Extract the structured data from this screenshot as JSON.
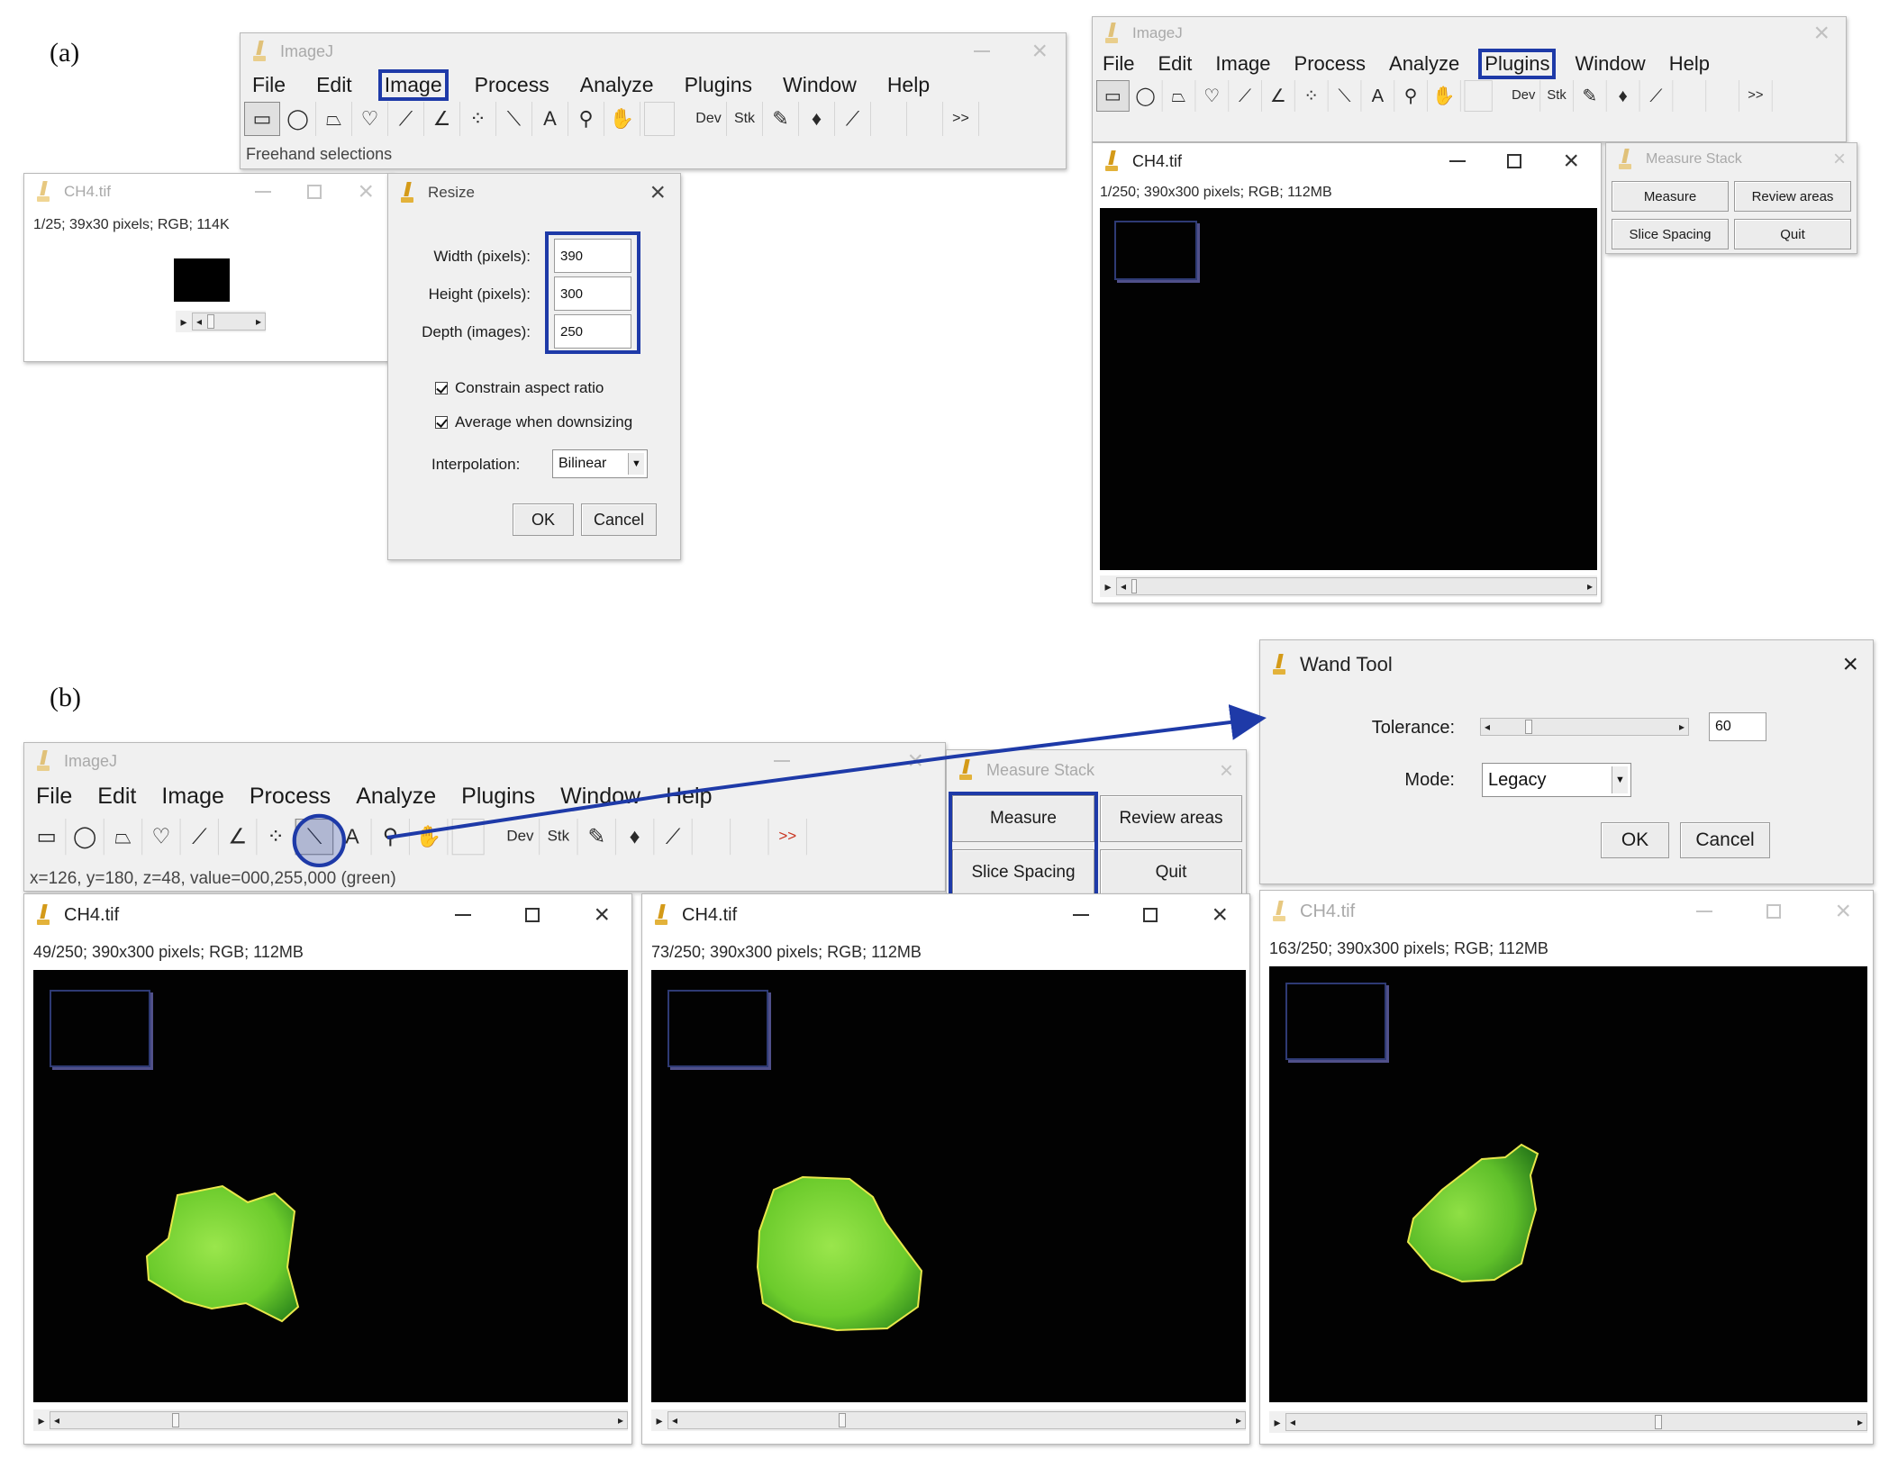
{
  "panel_a": {
    "label": "(a)"
  },
  "panel_b": {
    "label": "(b)"
  },
  "imagej": {
    "title": "ImageJ",
    "menus": [
      "File",
      "Edit",
      "Image",
      "Process",
      "Analyze",
      "Plugins",
      "Window",
      "Help"
    ],
    "tool_dev": "Dev",
    "tool_stk": "Stk",
    "more": ">>",
    "status_a": "Freehand selections",
    "status_b": "x=126, y=180, z=48, value=000,255,000 (green)"
  },
  "small_window": {
    "title": "CH4.tif",
    "info": "1/25; 39x30 pixels; RGB; 114K"
  },
  "resize_dialog": {
    "title": "Resize",
    "width_label": "Width (pixels):",
    "width_value": "390",
    "height_label": "Height (pixels):",
    "height_value": "300",
    "depth_label": "Depth (images):",
    "depth_value": "250",
    "constrain_label": "Constrain aspect ratio",
    "average_label": "Average when downsizing",
    "interpolation_label": "Interpolation:",
    "interpolation_value": "Bilinear",
    "ok": "OK",
    "cancel": "Cancel"
  },
  "stack_window_a": {
    "title": "CH4.tif",
    "info": "1/250; 390x300 pixels; RGB; 112MB"
  },
  "measure_stack": {
    "title": "Measure Stack",
    "measure": "Measure",
    "review": "Review areas",
    "slice_spacing": "Slice Spacing",
    "quit": "Quit"
  },
  "wand_tool": {
    "title": "Wand Tool",
    "tolerance_label": "Tolerance:",
    "tolerance_value": "60",
    "tolerance_fraction": 0.18,
    "mode_label": "Mode:",
    "mode_value": "Legacy",
    "ok": "OK",
    "cancel": "Cancel"
  },
  "slice_windows": [
    {
      "title": "CH4.tif",
      "info": "49/250; 390x300 pixels; RGB; 112MB",
      "slice_fraction": 0.2
    },
    {
      "title": "CH4.tif",
      "info": "73/250; 390x300 pixels; RGB; 112MB",
      "slice_fraction": 0.29
    },
    {
      "title": "CH4.tif",
      "info": "163/250; 390x300 pixels; RGB; 112MB",
      "slice_fraction": 0.65
    }
  ],
  "colors": {
    "highlight": "#1e3aa8",
    "blob": "#7cd93a",
    "blob_edge": "#e3e34a"
  }
}
